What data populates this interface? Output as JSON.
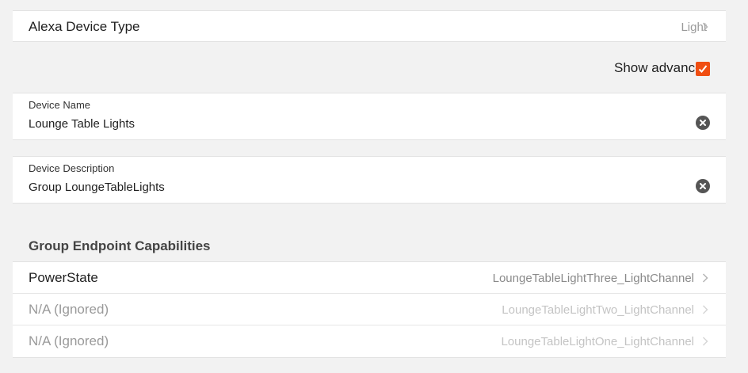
{
  "device_type": {
    "label": "Alexa Device Type",
    "value": "Light"
  },
  "advanced": {
    "label": "Show advanced",
    "checked": true,
    "color": "#f04e12"
  },
  "fields": {
    "name": {
      "label": "Device Name",
      "value": "Lounge Table Lights"
    },
    "description": {
      "label": "Device Description",
      "value": "Group LoungeTableLights"
    }
  },
  "capabilities": {
    "title": "Group Endpoint Capabilities",
    "items": [
      {
        "name": "PowerState",
        "value": "LoungeTableLightThree_LightChannel",
        "ignored": false
      },
      {
        "name": "N/A (Ignored)",
        "value": "LoungeTableLightTwo_LightChannel",
        "ignored": true
      },
      {
        "name": "N/A (Ignored)",
        "value": "LoungeTableLightOne_LightChannel",
        "ignored": true
      }
    ]
  },
  "icons": {
    "chevron": "chevron-right-icon",
    "clear": "clear-circle-x-icon",
    "check": "checkmark-icon"
  }
}
